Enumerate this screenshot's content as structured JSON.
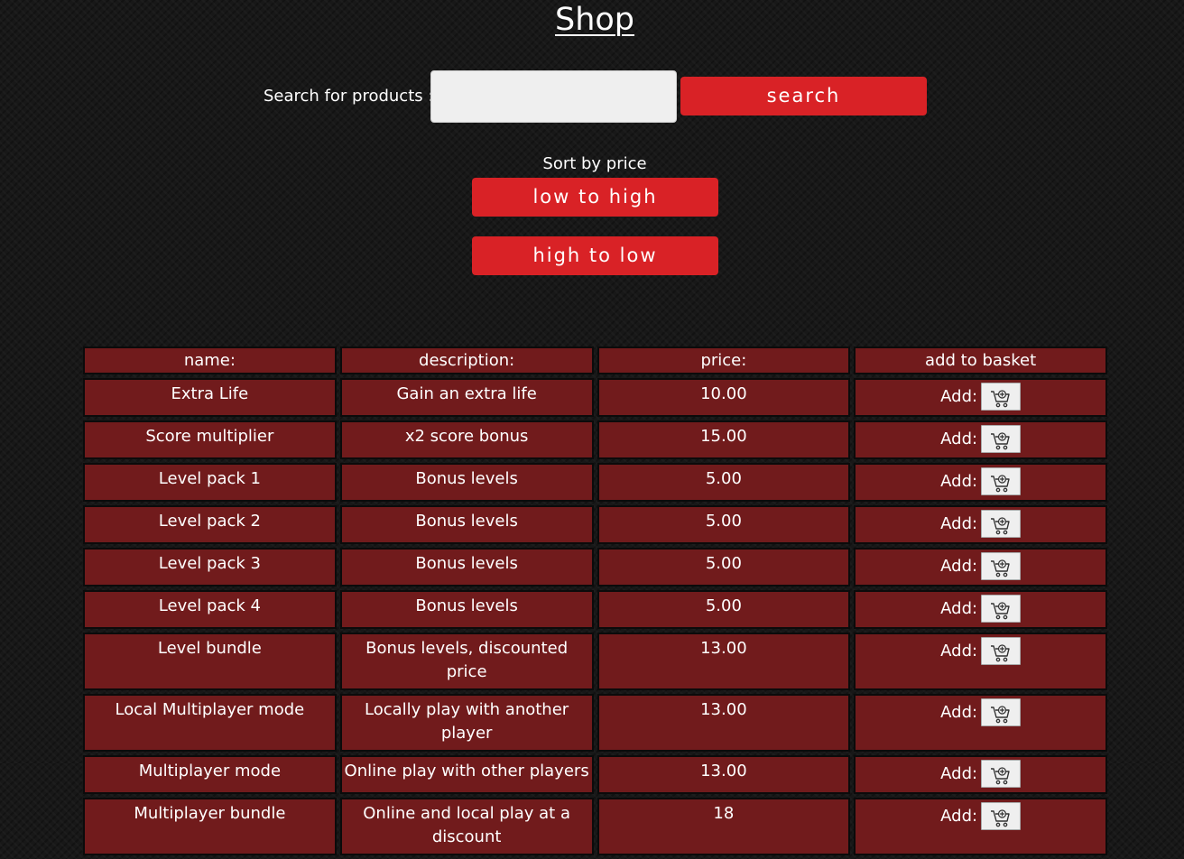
{
  "page": {
    "title": "Shop"
  },
  "search": {
    "label": "Search for products :",
    "value": "",
    "placeholder": "",
    "button_label": "search"
  },
  "sort": {
    "label": "Sort by price",
    "asc_label": "low to high",
    "desc_label": "high to low"
  },
  "table": {
    "headers": [
      "name:",
      "description:",
      "price:",
      "add to basket"
    ],
    "add_label": "Add:",
    "cart_icon": "cart-add-icon",
    "rows": [
      {
        "name": "Extra Life",
        "description": "Gain an extra life",
        "price": "10.00"
      },
      {
        "name": "Score multiplier",
        "description": "x2 score bonus",
        "price": "15.00"
      },
      {
        "name": "Level pack 1",
        "description": "Bonus levels",
        "price": "5.00"
      },
      {
        "name": "Level pack 2",
        "description": "Bonus levels",
        "price": "5.00"
      },
      {
        "name": "Level pack 3",
        "description": "Bonus levels",
        "price": "5.00"
      },
      {
        "name": "Level pack 4",
        "description": "Bonus levels",
        "price": "5.00"
      },
      {
        "name": "Level bundle",
        "description": "Bonus levels, discounted price",
        "price": "13.00"
      },
      {
        "name": "Local Multiplayer mode",
        "description": "Locally play with another player",
        "price": "13.00"
      },
      {
        "name": "Multiplayer mode",
        "description": "Online play with other players",
        "price": "13.00"
      },
      {
        "name": "Multiplayer bundle",
        "description": "Online and local play at a discount",
        "price": "18"
      }
    ]
  },
  "colors": {
    "background": "#181818",
    "button_red": "#d92226",
    "cell_red": "#711b1c",
    "text": "#ffffff"
  }
}
